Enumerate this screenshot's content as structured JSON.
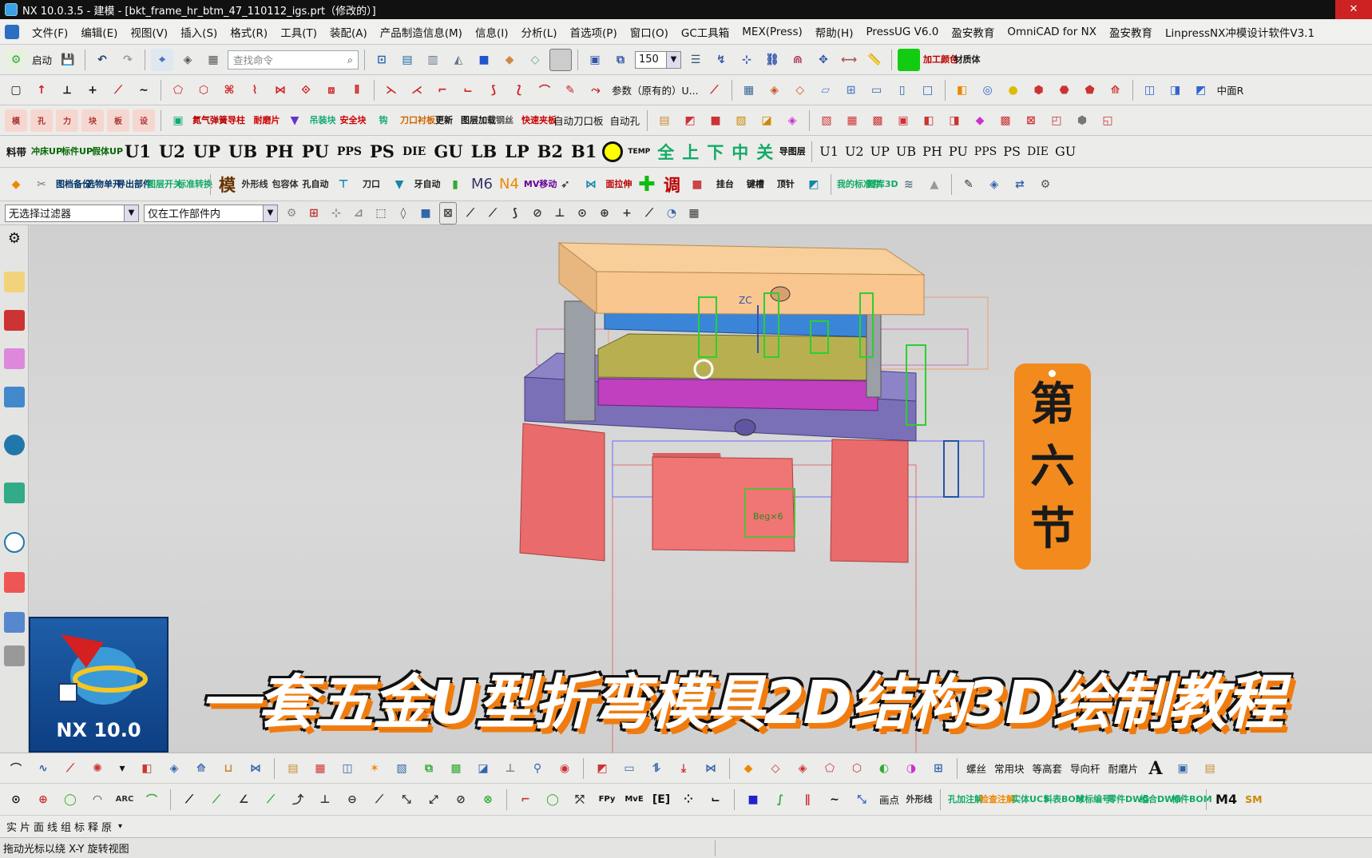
{
  "window": {
    "title": "NX 10.0.3.5 - 建模 - [bkt_frame_hr_btm_47_110112_igs.prt（修改的）]"
  },
  "menu": [
    "文件(F)",
    "编辑(E)",
    "视图(V)",
    "插入(S)",
    "格式(R)",
    "工具(T)",
    "装配(A)",
    "产品制造信息(M)",
    "信息(I)",
    "分析(L)",
    "首选项(P)",
    "窗口(O)",
    "GC工具箱",
    "MEX(Press)",
    "帮助(H)",
    "PressUG V6.0",
    "盈安教育",
    "OmniCAD for NX",
    "盈安教育",
    "LinpressNX冲模设计软件V3.1"
  ],
  "toolbar1": {
    "start_label": "启动",
    "search_placeholder": "查找命令",
    "zoom_value": "150",
    "right_labels": [
      "加工颜色",
      "材质体"
    ]
  },
  "toolbar2": {
    "param_label": "参数（原有的）U...",
    "right_label": "中面R"
  },
  "toolbar3": {
    "labels": [
      "自动刀口板",
      "自动孔"
    ],
    "small_labels": [
      "氮气弹簧",
      "导柱",
      "耐磨片",
      "吊装块",
      "安全块",
      "钩",
      "刀口衬板",
      "更新",
      "图层加载",
      "钢丝",
      "快速夹板"
    ]
  },
  "toolbar4": {
    "labels": [
      "料带",
      "冲床UP",
      "标件UP",
      "假体UP",
      "U1",
      "U2",
      "UP",
      "UB",
      "PH",
      "PU",
      "PPS",
      "PS",
      "DIE",
      "GU",
      "LB",
      "LP",
      "B2",
      "B1",
      "TEMP",
      "全",
      "上",
      "下",
      "中",
      "关",
      "导图层"
    ],
    "right_labels": [
      "U1",
      "U2",
      "UP",
      "UB",
      "PH",
      "PU",
      "PPS",
      "PS",
      "DIE",
      "GU"
    ]
  },
  "toolbar5": {
    "labels": [
      "图档备份",
      "选物单开",
      "导出部件",
      "图层开关",
      "标准转换",
      "模",
      "外形线",
      "包容体",
      "孔自动",
      "刀口",
      "牙自动",
      "M6",
      "N4",
      "MV移动",
      "面拉伸",
      "调",
      "挂台",
      "键槽",
      "顶针",
      "我的标准件",
      "图库3D"
    ]
  },
  "filters": {
    "type_filter": "无选择过滤器",
    "scope_filter": "仅在工作部件内"
  },
  "viewport": {
    "axis_label": "ZC",
    "part_label": "Beg×6"
  },
  "overlay": {
    "logo_text": "NX 10.0",
    "badge_chars": [
      "第",
      "六",
      "节"
    ],
    "title": "一套五金U型折弯模具2D结构3D绘制教程"
  },
  "bottom1": {
    "labels": [
      "螺丝",
      "常用块",
      "等高套",
      "导向杆",
      "耐磨片"
    ]
  },
  "bottom2": {
    "labels": [
      "画点",
      "外形线",
      "孔加注解",
      "检查注解",
      "实体UCS",
      "料表BOM",
      "球标编号",
      "零件DWG",
      "组合DWG",
      "标件BOM",
      "M4",
      "SM"
    ]
  },
  "bottom3": {
    "text": "实片面线组标释原"
  },
  "status": {
    "message": "拖动光标以绕 X-Y 旋转视图"
  },
  "colors": {
    "accent_orange": "#f28a1e",
    "nx_blue": "#1e5ea8"
  }
}
